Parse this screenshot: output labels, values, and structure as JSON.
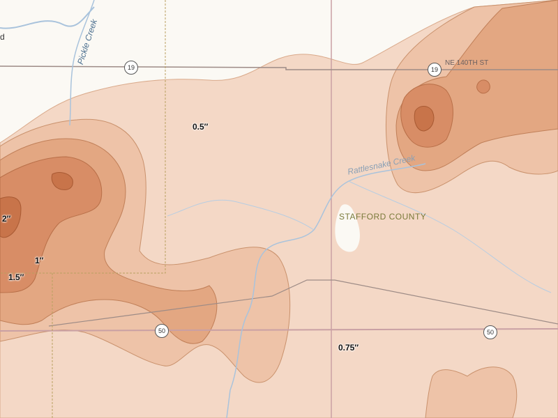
{
  "labels": {
    "county": "STAFFORD COUNTY",
    "creek_rattlesnake": "Rattlesnake Creek",
    "creek_pickle": "Pickle Creek",
    "street": "NE 140TH ST",
    "corner_fragment": "d"
  },
  "shields": {
    "route19_west": "19",
    "route19_east": "19",
    "us50_west": "50",
    "us50_east": "50"
  },
  "contours": {
    "half": "0.5″",
    "three_quarter": "0.75″",
    "one": "1″",
    "one_half": "1.5″",
    "two": "2″"
  },
  "colors": {
    "band_05": "#f4d8c6",
    "band_075": "#eec3a8",
    "band_1": "#e3a782",
    "band_15": "#d88d66",
    "band_2": "#c8744a",
    "contour_stroke": "#c9916c",
    "road": "#c9a0a4",
    "highway": "#9d8b86",
    "water": "#a9c3dc"
  }
}
